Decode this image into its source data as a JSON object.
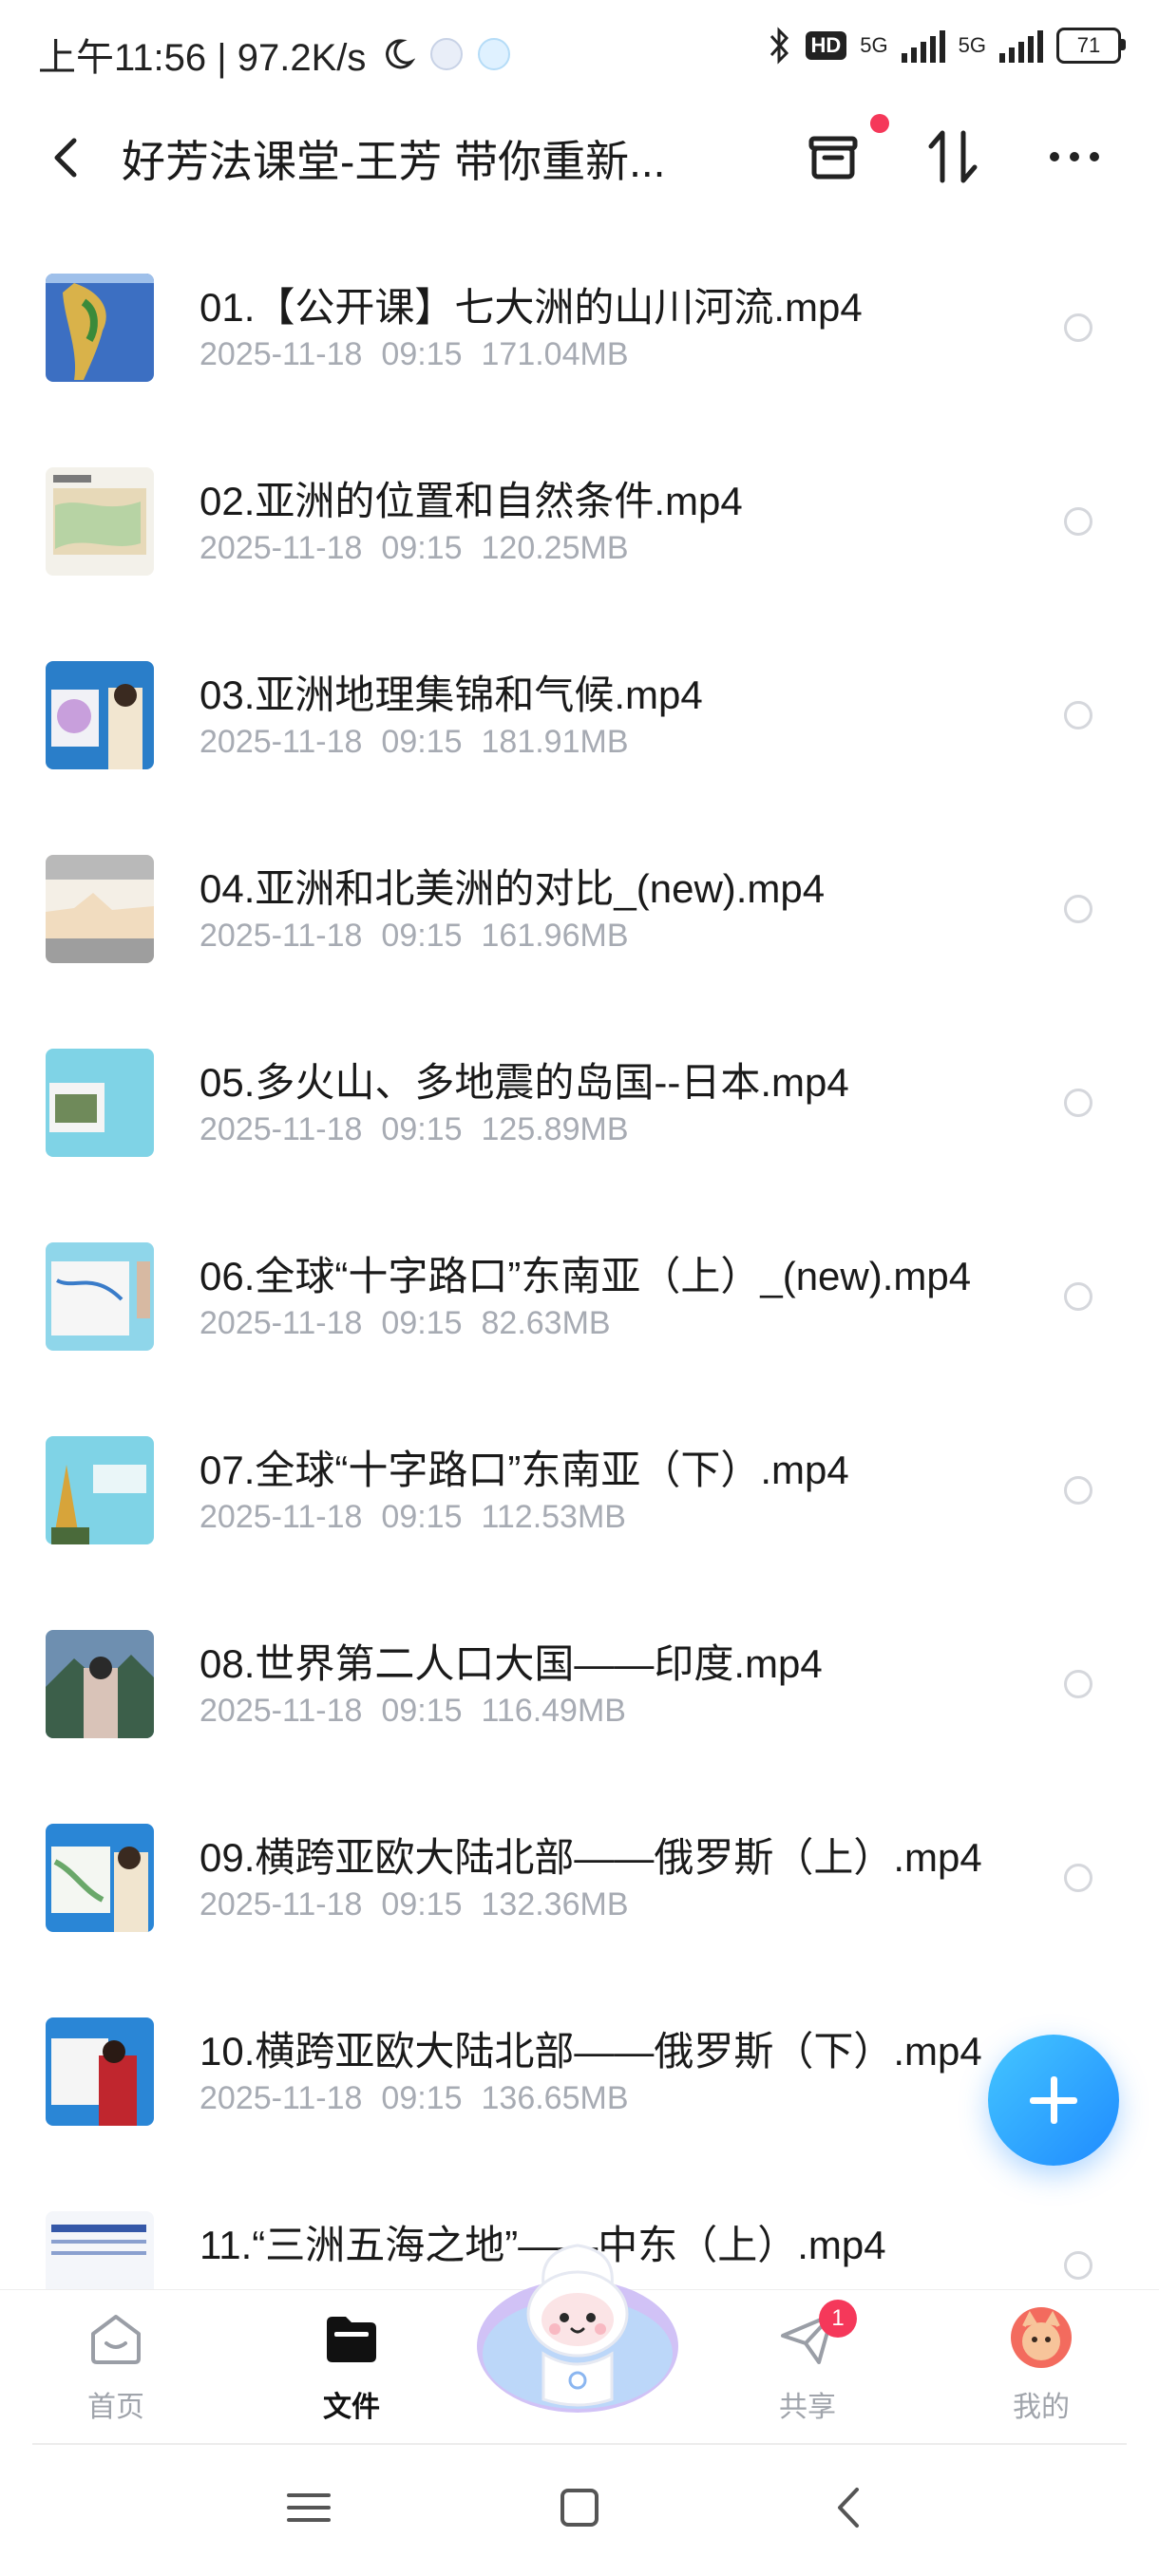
{
  "status_bar": {
    "time_speed": "上午11:56 | 97.2K/s",
    "hd_label": "HD",
    "net1": "5G",
    "net2": "5G",
    "battery": "71"
  },
  "header": {
    "title": "好芳法课堂-王芳 带你重新..."
  },
  "files": [
    {
      "name": "01.【公开课】七大洲的山川河流.mp4",
      "date": "2025-11-18",
      "time": "09:15",
      "size": "171.04MB"
    },
    {
      "name": "02.亚洲的位置和自然条件.mp4",
      "date": "2025-11-18",
      "time": "09:15",
      "size": "120.25MB"
    },
    {
      "name": "03.亚洲地理集锦和气候.mp4",
      "date": "2025-11-18",
      "time": "09:15",
      "size": "181.91MB"
    },
    {
      "name": "04.亚洲和北美洲的对比_(new).mp4",
      "date": "2025-11-18",
      "time": "09:15",
      "size": "161.96MB"
    },
    {
      "name": "05.多火山、多地震的岛国--日本.mp4",
      "date": "2025-11-18",
      "time": "09:15",
      "size": "125.89MB"
    },
    {
      "name": "06.全球“十字路口”东南亚（上）_(new).mp4",
      "date": "2025-11-18",
      "time": "09:15",
      "size": "82.63MB"
    },
    {
      "name": "07.全球“十字路口”东南亚（下）.mp4",
      "date": "2025-11-18",
      "time": "09:15",
      "size": "112.53MB"
    },
    {
      "name": "08.世界第二人口大国——印度.mp4",
      "date": "2025-11-18",
      "time": "09:15",
      "size": "116.49MB"
    },
    {
      "name": "09.横跨亚欧大陆北部——俄罗斯（上）.mp4",
      "date": "2025-11-18",
      "time": "09:15",
      "size": "132.36MB"
    },
    {
      "name": "10.横跨亚欧大陆北部——俄罗斯（下）.mp4",
      "date": "2025-11-18",
      "time": "09:15",
      "size": "136.65MB"
    },
    {
      "name": "11.“三洲五海之地”——中东（上）.mp4",
      "date": "",
      "time": "",
      "size": ""
    }
  ],
  "bottom_nav": {
    "home": "首页",
    "files": "文件",
    "share": "共享",
    "share_badge": "1",
    "mine": "我的"
  },
  "colors": {
    "accent": "#1f8bff",
    "badge": "#f5385a",
    "meta_text": "#a7abb3"
  }
}
